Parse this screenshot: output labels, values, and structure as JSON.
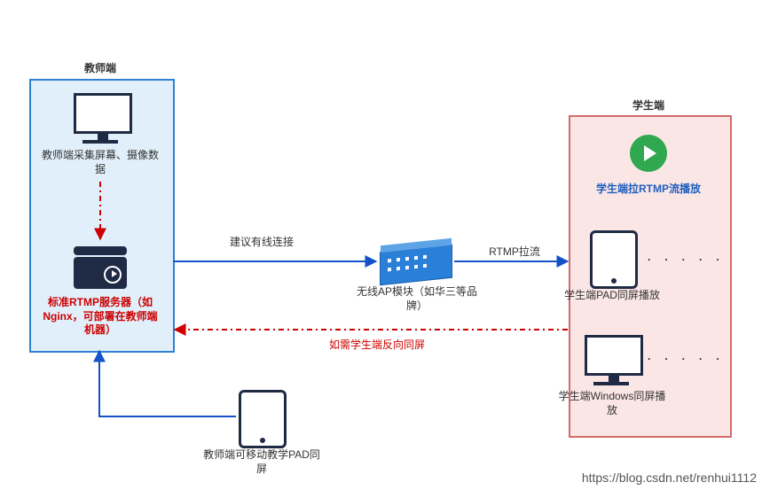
{
  "diagram": {
    "teacher_title": "教师端",
    "student_title": "学生端",
    "teacher_capture": "教师端采集屏幕、摄像数据",
    "rtmp_server": "标准RTMP服务器（如Nginx，可部署在教师端机器）",
    "wired_advice": "建议有线连接",
    "ap_module": "无线AP模块（如华三等品牌）",
    "rtmp_pull": "RTMP拉流",
    "student_pull_play": "学生端拉RTMP流播放",
    "student_pad": "学生端PAD同屏播放",
    "student_windows": "学生端Windows同屏播放",
    "reverse_mirror": "如需学生端反向同屏",
    "teacher_pad": "教师端可移动教学PAD同屏",
    "watermark": "https://blog.csdn.net/renhui1112",
    "dots": "·  ·  ·  ·  ·"
  }
}
